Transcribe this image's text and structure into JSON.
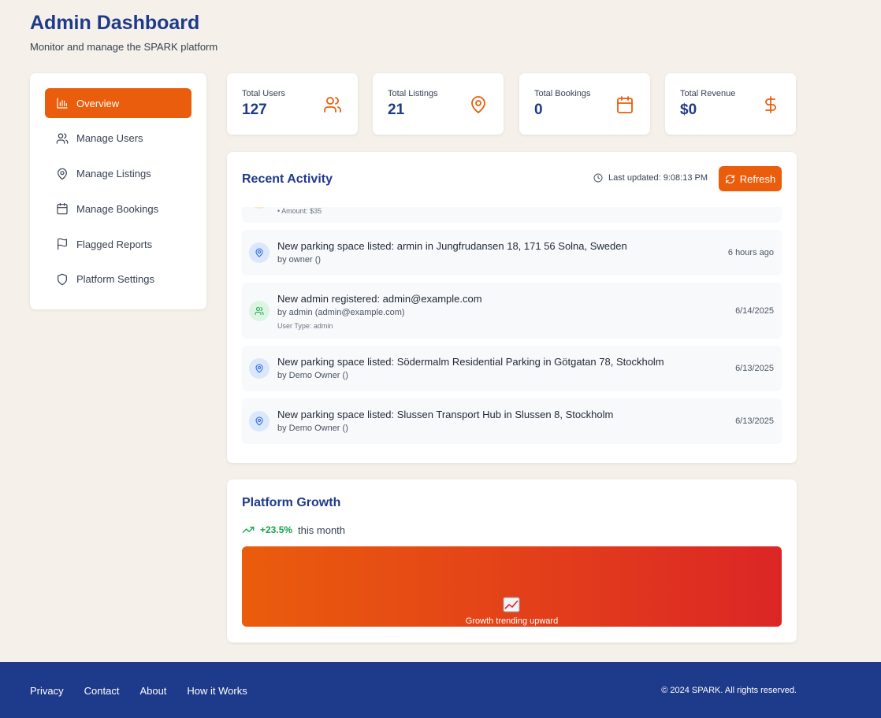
{
  "header": {
    "title": "Admin Dashboard",
    "subtitle": "Monitor and manage the SPARK platform"
  },
  "sidebar": {
    "items": [
      {
        "label": "Overview",
        "icon": "bar-chart-icon",
        "active": true
      },
      {
        "label": "Manage Users",
        "icon": "users-icon"
      },
      {
        "label": "Manage Listings",
        "icon": "map-pin-icon"
      },
      {
        "label": "Manage Bookings",
        "icon": "calendar-icon"
      },
      {
        "label": "Flagged Reports",
        "icon": "flag-icon"
      },
      {
        "label": "Platform Settings",
        "icon": "shield-icon"
      }
    ]
  },
  "stats": [
    {
      "label": "Total Users",
      "value": "127",
      "icon": "users-icon"
    },
    {
      "label": "Total Listings",
      "value": "21",
      "icon": "map-pin-icon"
    },
    {
      "label": "Total Bookings",
      "value": "0",
      "icon": "calendar-icon"
    },
    {
      "label": "Total Revenue",
      "value": "$0",
      "icon": "dollar-icon"
    }
  ],
  "activity": {
    "title": "Recent Activity",
    "last_updated": "Last updated: 9:08:13 PM",
    "refresh_label": "Refresh",
    "items": [
      {
        "type": "payment",
        "title": "",
        "by": "",
        "extra": "• Amount: $35",
        "time": ""
      },
      {
        "type": "listing",
        "title": "New parking space listed: armin in Jungfrudansen 18, 171 56 Solna, Sweden",
        "by": "by owner ()",
        "extra": "",
        "time": "6 hours ago"
      },
      {
        "type": "user",
        "title": "New admin registered: admin@example.com",
        "by": "by admin (admin@example.com)",
        "extra": "User Type: admin",
        "time": "6/14/2025"
      },
      {
        "type": "listing",
        "title": "New parking space listed: Södermalm Residential Parking in Götgatan 78, Stockholm",
        "by": "by Demo Owner ()",
        "extra": "",
        "time": "6/13/2025"
      },
      {
        "type": "listing",
        "title": "New parking space listed: Slussen Transport Hub in Slussen 8, Stockholm",
        "by": "by Demo Owner ()",
        "extra": "",
        "time": "6/13/2025"
      }
    ]
  },
  "growth": {
    "title": "Platform Growth",
    "percent": "+23.5%",
    "suffix": "this month",
    "banner_text": "Growth trending upward",
    "banner_icon": "chart-increasing-emoji"
  },
  "footer": {
    "links": [
      "Privacy",
      "Contact",
      "About",
      "How it Works"
    ],
    "copyright": "© 2024 SPARK. All rights reserved."
  },
  "colors": {
    "accent": "#ea5d0c",
    "brand": "#1e3a8a",
    "background": "#f5f1ea",
    "growth_green": "#16a34a",
    "gradient_end": "#dc2626"
  }
}
